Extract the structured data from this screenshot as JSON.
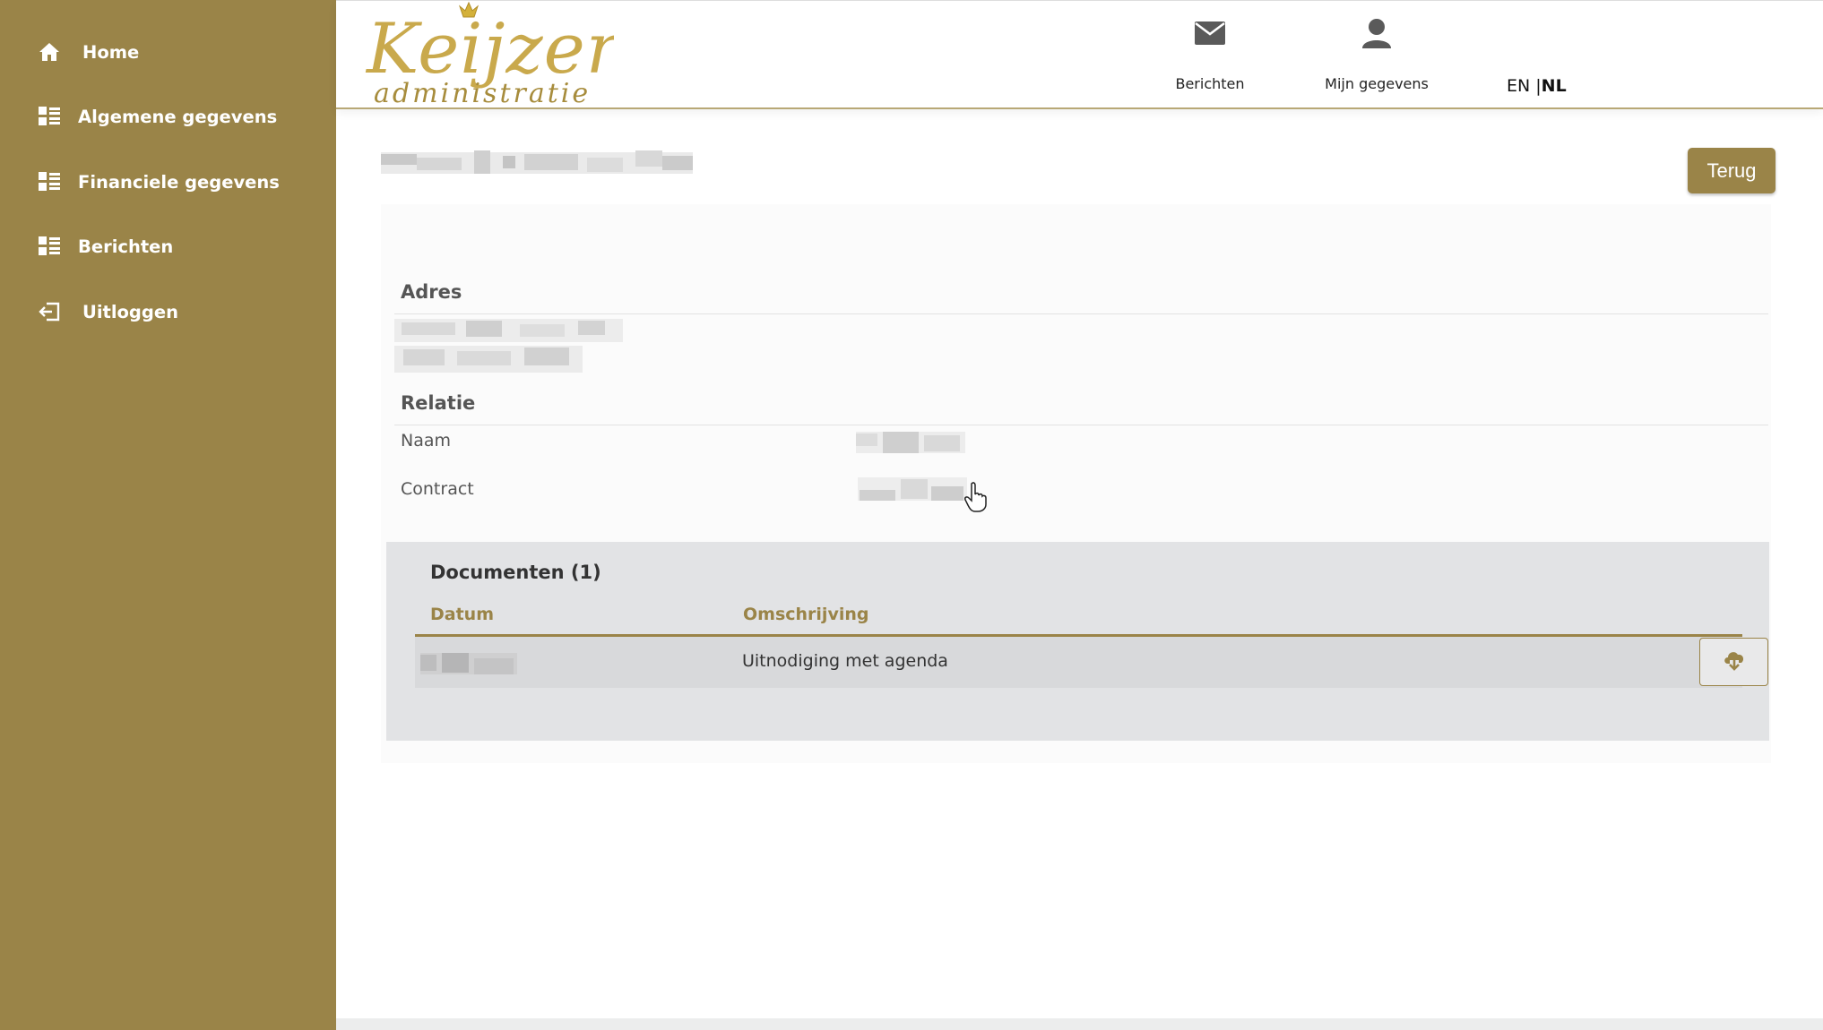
{
  "sidebar": {
    "items": [
      {
        "label": "Home",
        "icon": "home-icon"
      },
      {
        "label": "Algemene gegevens",
        "icon": "list-icon"
      },
      {
        "label": "Financiele gegevens",
        "icon": "list-icon"
      },
      {
        "label": "Berichten",
        "icon": "list-icon"
      },
      {
        "label": "Uitloggen",
        "icon": "logout-icon"
      }
    ]
  },
  "header": {
    "logo_top": "Keijzer",
    "logo_bottom": "administratie",
    "messages_label": "Berichten",
    "profile_label": "Mijn gegevens",
    "lang_en": "EN",
    "lang_sep": "|",
    "lang_nl": "NL",
    "active_lang": "NL"
  },
  "main": {
    "back_label": "Terug",
    "address_title": "Adres",
    "relation_title": "Relatie",
    "name_label": "Naam",
    "contract_label": "Contract",
    "documents": {
      "title": "Documenten (1)",
      "columns": [
        "Datum",
        "Omschrijving"
      ],
      "rows": [
        {
          "description": "Uitnodiging met agenda"
        }
      ]
    }
  },
  "colors": {
    "brand": "#9a8448",
    "logo_gold": "#c9a94c",
    "panel_bg": "#e2e3e5"
  }
}
